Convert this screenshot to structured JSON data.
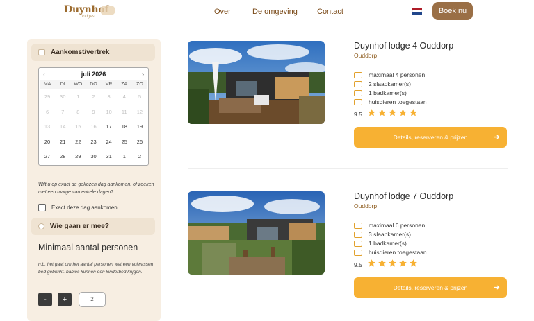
{
  "header": {
    "logo": "Duynhof",
    "logo_tag": "lodges",
    "nav": [
      {
        "label": "Over"
      },
      {
        "label": "De omgeving"
      },
      {
        "label": "Contact"
      }
    ],
    "book_label": "Boek nu",
    "flag_colors": [
      "#ae1c28",
      "#ffffff",
      "#21468b"
    ]
  },
  "sidebar": {
    "dates_title": "Aankomst/vertrek",
    "calendar": {
      "month": "juli 2026",
      "prev": "‹",
      "next": "›",
      "weekdays": [
        "MA",
        "DI",
        "WO",
        "DO",
        "VR",
        "ZA",
        "ZO"
      ],
      "days": [
        {
          "d": "29",
          "a": false
        },
        {
          "d": "30",
          "a": false
        },
        {
          "d": "1",
          "a": false
        },
        {
          "d": "2",
          "a": false
        },
        {
          "d": "3",
          "a": false
        },
        {
          "d": "4",
          "a": false
        },
        {
          "d": "5",
          "a": false
        },
        {
          "d": "6",
          "a": false
        },
        {
          "d": "7",
          "a": false
        },
        {
          "d": "8",
          "a": false
        },
        {
          "d": "9",
          "a": false
        },
        {
          "d": "10",
          "a": false
        },
        {
          "d": "11",
          "a": false
        },
        {
          "d": "12",
          "a": false
        },
        {
          "d": "13",
          "a": false
        },
        {
          "d": "14",
          "a": false
        },
        {
          "d": "15",
          "a": false
        },
        {
          "d": "16",
          "a": false
        },
        {
          "d": "17",
          "a": true
        },
        {
          "d": "18",
          "a": true
        },
        {
          "d": "19",
          "a": true
        },
        {
          "d": "20",
          "a": true
        },
        {
          "d": "21",
          "a": true
        },
        {
          "d": "22",
          "a": true
        },
        {
          "d": "23",
          "a": true
        },
        {
          "d": "24",
          "a": true
        },
        {
          "d": "25",
          "a": true
        },
        {
          "d": "26",
          "a": true
        },
        {
          "d": "27",
          "a": true
        },
        {
          "d": "28",
          "a": true
        },
        {
          "d": "29",
          "a": true
        },
        {
          "d": "30",
          "a": true
        },
        {
          "d": "31",
          "a": true
        },
        {
          "d": "1",
          "a": true
        },
        {
          "d": "2",
          "a": true
        }
      ]
    },
    "hint": "Wilt u op exact de gekozen dag aankomen, of zoeken met een marge van enkele dagen?",
    "exact_label": "Exact deze dag aankomen",
    "guests_title": "Wie gaan er mee?",
    "min_title": "Minimaal aantal personen",
    "note": "n.b. het gaat om het aantal personen wat een volwassen bed gebruikt. babies kunnen een kinderbed krijgen.",
    "minus": "-",
    "plus": "+",
    "persons": "2"
  },
  "lodges": [
    {
      "title": "Duynhof lodge 4 Ouddorp",
      "location": "Ouddorp",
      "features": [
        "maximaal 4 personen",
        "2 slaapkamer(s)",
        "1 badkamer(s)",
        "huisdieren toegestaan"
      ],
      "score": "9.5",
      "stars": 5,
      "button": "Details, reserveren & prijzen"
    },
    {
      "title": "Duynhof lodge 7 Ouddorp",
      "location": "Ouddorp",
      "features": [
        "maximaal 6 personen",
        "3 slaapkamer(s)",
        "1 badkamer(s)",
        "huisdieren toegestaan"
      ],
      "score": "9.5",
      "stars": 5,
      "button": "Details, reserveren & prijzen"
    }
  ],
  "colors": {
    "accent": "#f7b133",
    "brand": "#9a6f46",
    "sidebar_bg": "#f7eee2"
  }
}
